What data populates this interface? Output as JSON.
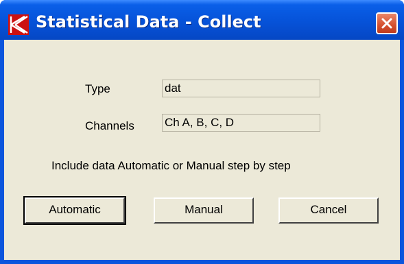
{
  "window": {
    "title": "Statistical Data - Collect",
    "app_icon": "k-logo-icon",
    "close_icon": "close-icon"
  },
  "form": {
    "type_label": "Type",
    "type_value": "dat",
    "channels_label": "Channels",
    "channels_value": "Ch A, B, C, D",
    "instruction": "Include data Automatic or Manual step by step"
  },
  "buttons": {
    "automatic": "Automatic",
    "manual": "Manual",
    "cancel": "Cancel"
  },
  "colors": {
    "titlebar": "#0652d8",
    "client_bg": "#ece9d8",
    "close_btn": "#d5502f",
    "logo": "#cc1111"
  }
}
